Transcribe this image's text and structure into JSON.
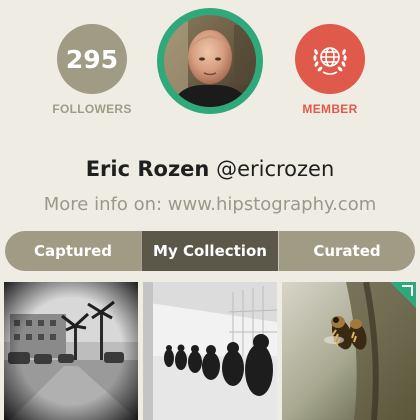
{
  "stats": {
    "followers_count": "295",
    "followers_label": "FOLLOWERS",
    "member_label": "MEMBER",
    "member_icon": "globe-laurel-icon"
  },
  "profile": {
    "name": "Eric Rozen",
    "handle": "@ericrozen",
    "more_info": "More info on: www.hipstography.com"
  },
  "tabs": [
    {
      "label": "Captured",
      "active": false
    },
    {
      "label": "My Collection",
      "active": true
    },
    {
      "label": "Curated",
      "active": false
    }
  ],
  "colors": {
    "background": "#efece4",
    "followers_accent": "#9f9b85",
    "member_accent": "#df5a4a",
    "avatar_ring": "#2fa97c",
    "tab_active": "#5b5849",
    "corner_badge": "#2fa97c"
  }
}
